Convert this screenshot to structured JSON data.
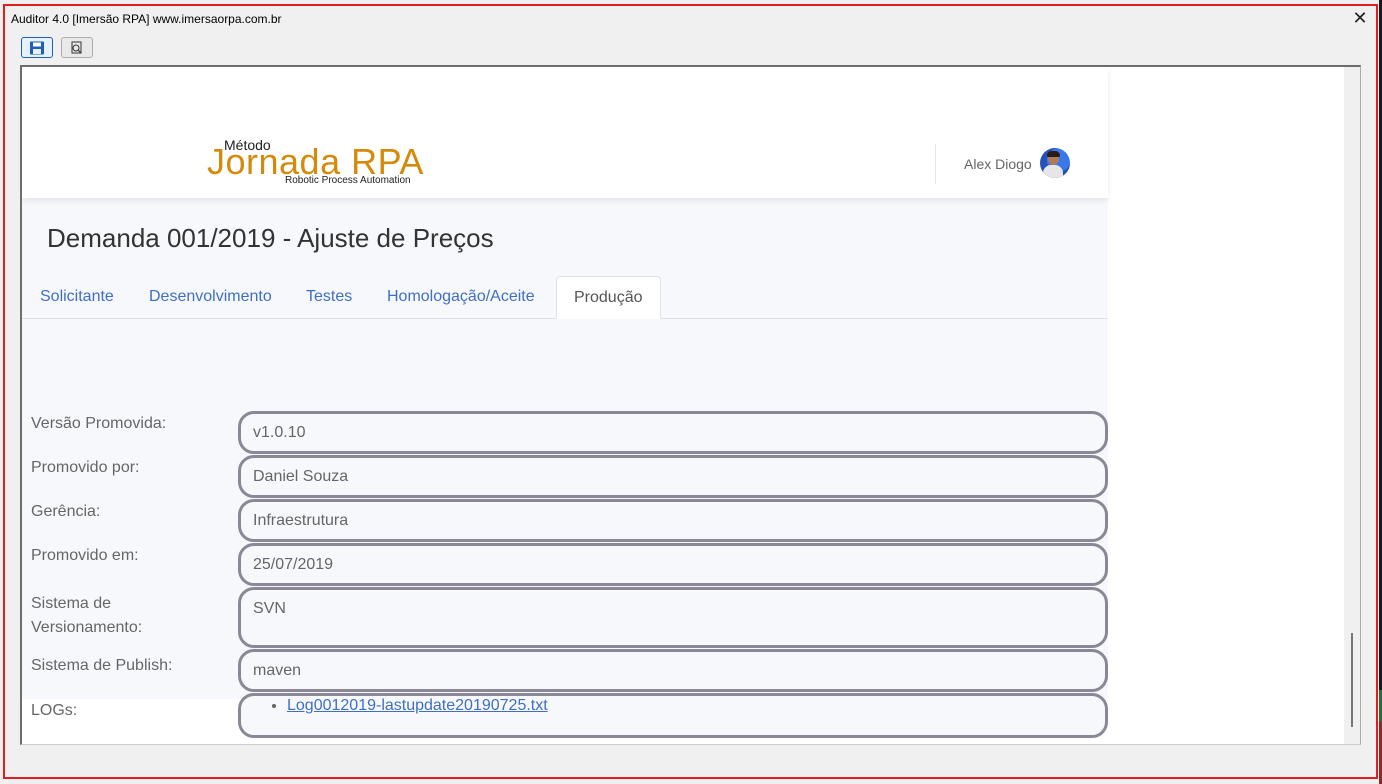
{
  "window": {
    "title": "Auditor 4.0 [Imersão RPA] www.imersaorpa.com.br",
    "close_glyph": "✕"
  },
  "toolbar": {
    "save_icon": "floppy-disk-icon",
    "preview_icon": "print-preview-icon"
  },
  "header": {
    "logo_metodo": "Método",
    "logo_main": "Jornada RPA",
    "logo_sub": "Robotic Process Automation",
    "user_name": "Alex Diogo"
  },
  "page": {
    "title": "Demanda 001/2019 - Ajuste de Preços"
  },
  "tabs": [
    {
      "label": "Solicitante",
      "active": false
    },
    {
      "label": "Desenvolvimento",
      "active": false
    },
    {
      "label": "Testes",
      "active": false
    },
    {
      "label": "Homologação/Aceite",
      "active": false
    },
    {
      "label": "Produção",
      "active": true
    }
  ],
  "form": {
    "fields": [
      {
        "label": "Versão Promovida:",
        "value": "v1.0.10"
      },
      {
        "label": "Promovido por:",
        "value": "Daniel Souza"
      },
      {
        "label": "Gerência:",
        "value": "Infraestrutura"
      },
      {
        "label": "Promovido em:",
        "value": "25/07/2019"
      },
      {
        "label": "Sistema de Versionamento:",
        "label_line1": "Sistema de",
        "label_line2": "Versionamento:",
        "value": "SVN"
      },
      {
        "label": "Sistema de Publish:",
        "value": "maven"
      }
    ],
    "logs_label": "LOGs:",
    "logs": [
      "Log0012019-lastupdate20190725.txt"
    ]
  },
  "colors": {
    "accent": "#3f6fc4",
    "logo": "#d48a0a",
    "window_border": "#e02020",
    "field_border": "#8a8896"
  }
}
